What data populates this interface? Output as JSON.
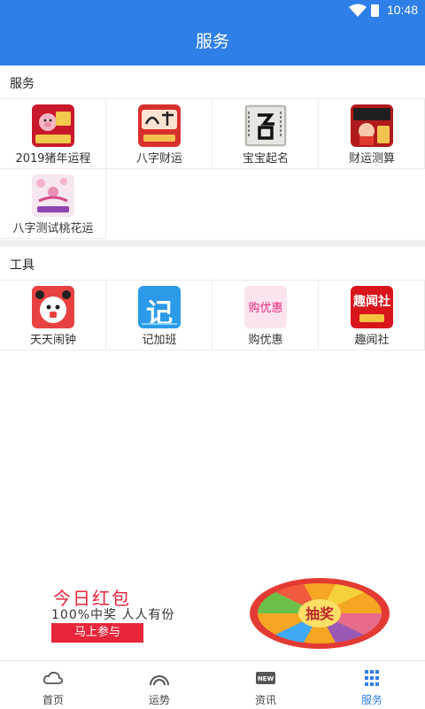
{
  "status_bar": {
    "time": "10:48"
  },
  "app_bar": {
    "title": "服务"
  },
  "services": {
    "header": "服务",
    "items": [
      {
        "label": "2019猪年运程",
        "icon": "pig-year-fortune-icon"
      },
      {
        "label": "八字财运",
        "icon": "bazi-wealth-icon"
      },
      {
        "label": "宝宝起名",
        "icon": "baby-naming-icon"
      },
      {
        "label": "财运测算",
        "icon": "wealth-reckoning-icon"
      },
      {
        "label": "八字测试桃花运",
        "icon": "peach-blossom-icon"
      }
    ]
  },
  "tools": {
    "header": "工具",
    "items": [
      {
        "label": "天天闹钟",
        "icon": "alarm-clock-icon"
      },
      {
        "label": "记加班",
        "icon": "overtime-record-icon",
        "glyph": "记"
      },
      {
        "label": "购优惠",
        "icon": "shopping-discount-icon",
        "glyph": "购优惠"
      },
      {
        "label": "趣闻社",
        "icon": "fun-news-icon",
        "glyph": "趣闻社"
      }
    ]
  },
  "banner": {
    "headline": "今日红包",
    "subline": "100%中奖 人人有份",
    "button": "马上参与",
    "wheel_center": "抽奖"
  },
  "tab_bar": {
    "tabs": [
      {
        "label": "首页",
        "icon": "cloud-icon",
        "active": false
      },
      {
        "label": "运势",
        "icon": "rainbow-arc-icon",
        "active": false
      },
      {
        "label": "资讯",
        "icon": "new-badge-icon",
        "badge": "NEW",
        "active": false
      },
      {
        "label": "服务",
        "icon": "grid-icon",
        "active": true
      }
    ]
  },
  "colors": {
    "primary": "#2f7fe8",
    "accent_red": "#e8263a",
    "divider": "#efefef"
  }
}
